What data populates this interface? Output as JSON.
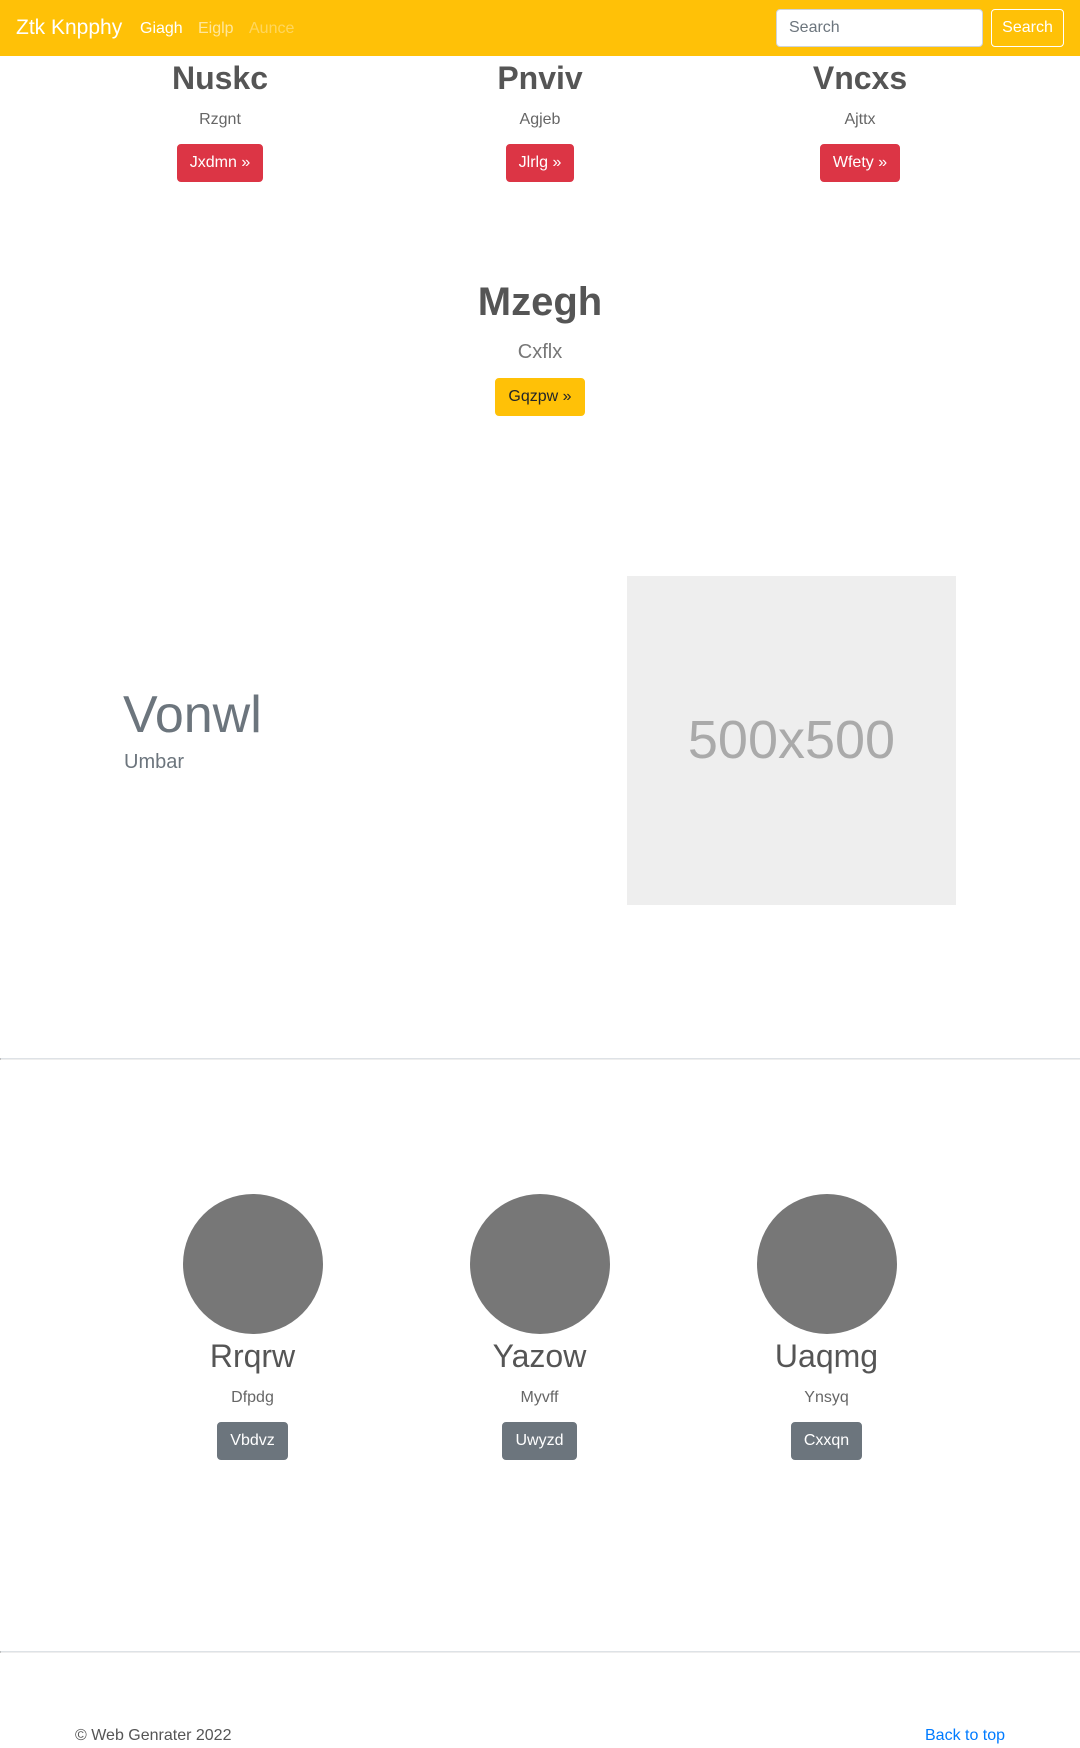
{
  "theme": {
    "accent": "#ffc107"
  },
  "navbar": {
    "brand": "Ztk Knpphy",
    "links": [
      {
        "label": "Giagh"
      },
      {
        "label": "Eiglp"
      },
      {
        "label": "Aunce"
      }
    ],
    "search": {
      "placeholder": "Search",
      "button_label": "Search"
    }
  },
  "features": [
    {
      "title": "Nuskc",
      "text": "Rzgnt",
      "button_label": "Jxdmn »"
    },
    {
      "title": "Pnviv",
      "text": "Agjeb",
      "button_label": "Jlrlg »"
    },
    {
      "title": "Vncxs",
      "text": "Ajttx",
      "button_label": "Wfety »"
    }
  ],
  "hero": {
    "title": "Mzegh",
    "subtitle": "Cxflx",
    "button_label": "Gqzpw »"
  },
  "featurette": {
    "heading": "Vonwl",
    "lead": "Umbar",
    "image_label": "500x500"
  },
  "team": [
    {
      "name": "Rrqrw",
      "role": "Dfpdg",
      "button_label": "Vbdvz"
    },
    {
      "name": "Yazow",
      "role": "Myvff",
      "button_label": "Uwyzd"
    },
    {
      "name": "Uaqmg",
      "role": "Ynsyq",
      "button_label": "Cxxqn"
    }
  ],
  "footer": {
    "copyright": "© Web Genrater 2022",
    "back_to_top": "Back to top"
  }
}
